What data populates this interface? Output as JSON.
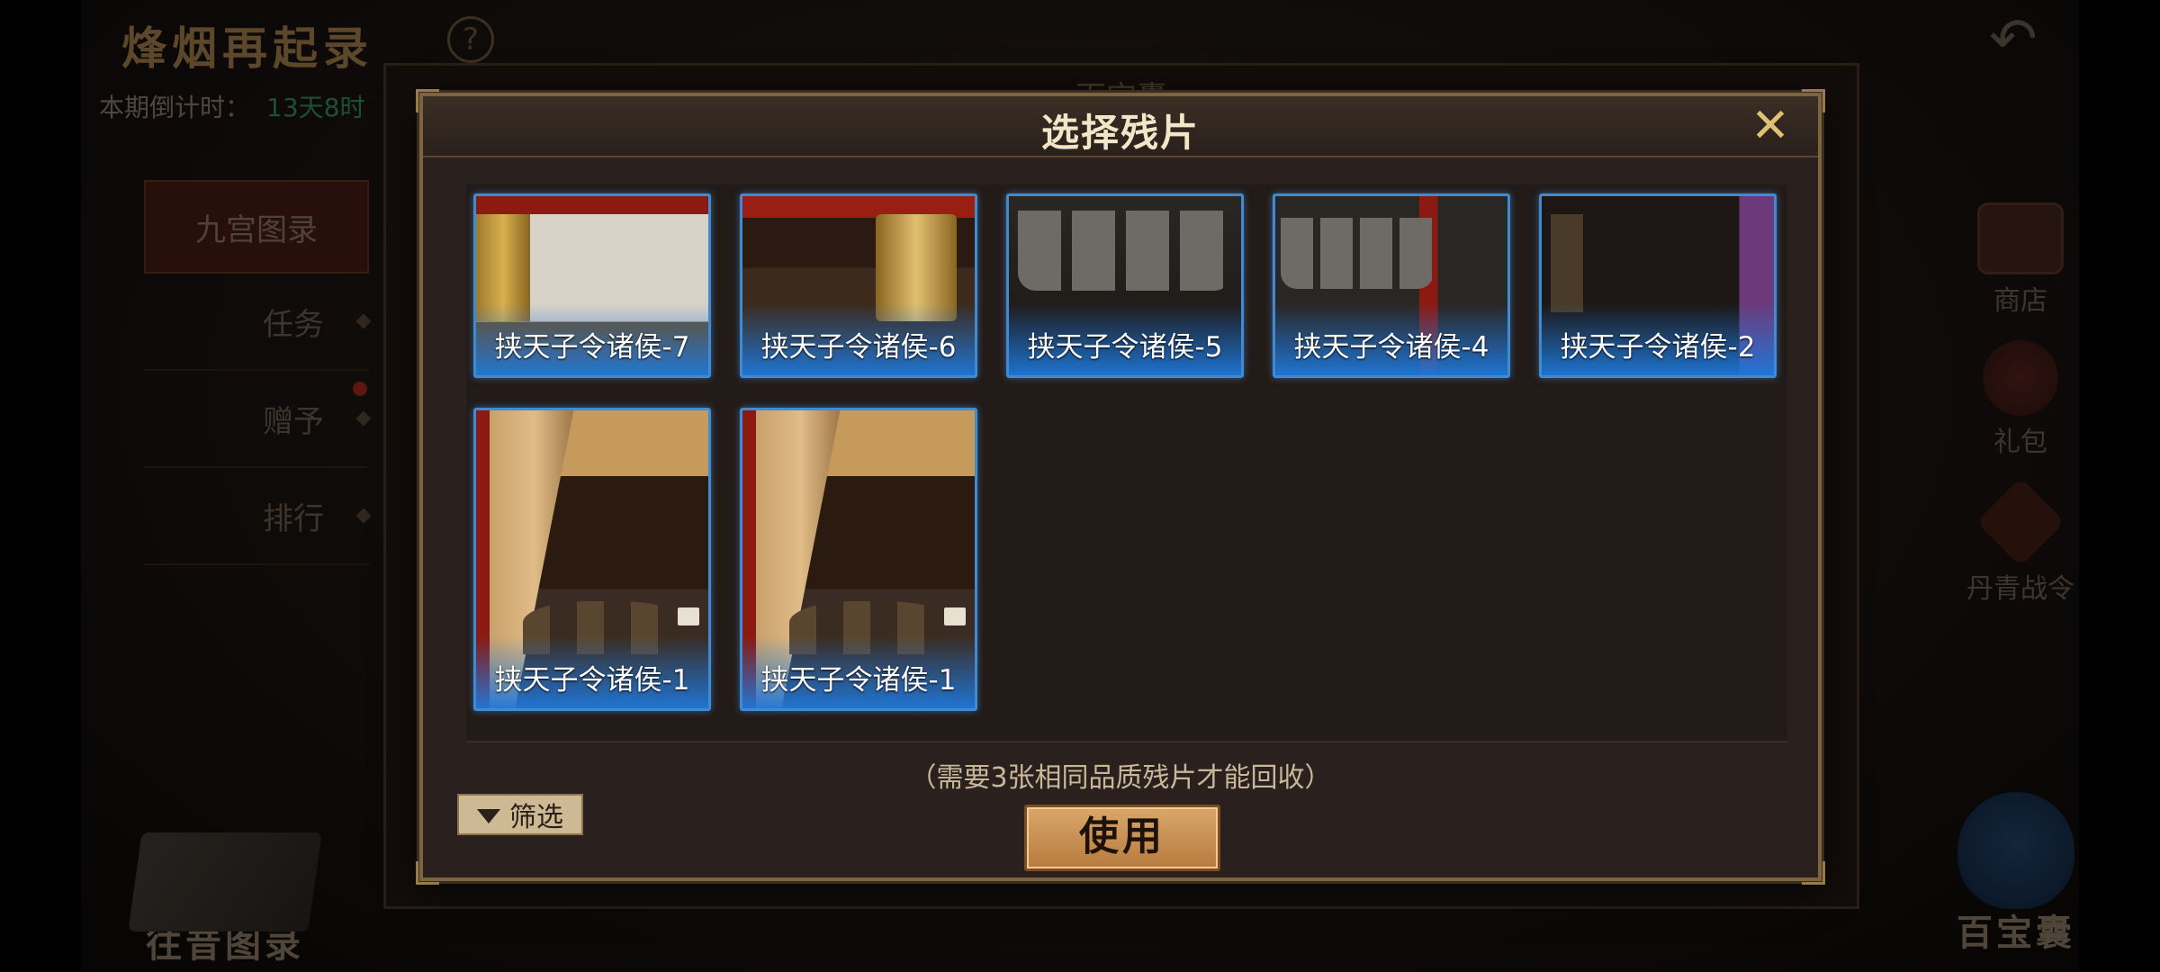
{
  "background": {
    "event_title": "烽烟再起录",
    "help_icon": "?",
    "countdown_label": "本期倒计时：",
    "countdown_value": "13天8时",
    "left_menu": [
      {
        "label": "九宫图录"
      },
      {
        "label": "任务"
      },
      {
        "label": "赠予"
      },
      {
        "label": "排行"
      }
    ],
    "side_buttons": [
      {
        "label": "商店",
        "icon": "chest-icon"
      },
      {
        "label": "礼包",
        "icon": "gift-bag-icon"
      },
      {
        "label": "丹青战令",
        "icon": "battle-pass-icon"
      }
    ],
    "past_catalog_label": "往昔图录",
    "treasure_bag_label": "百宝囊",
    "back_panel_title": "百宝囊"
  },
  "modal": {
    "title": "选择残片",
    "close_icon": "close-icon",
    "fragments": [
      {
        "name": "挟天子令诸侯-7"
      },
      {
        "name": "挟天子令诸侯-6"
      },
      {
        "name": "挟天子令诸侯-5"
      },
      {
        "name": "挟天子令诸侯-4"
      },
      {
        "name": "挟天子令诸侯-2"
      },
      {
        "name": "挟天子令诸侯-1"
      },
      {
        "name": "挟天子令诸侯-1"
      }
    ],
    "hint": "（需要3张相同品质残片才能回收）",
    "filter_label": "筛选",
    "use_label": "使用"
  },
  "colors": {
    "card_border": "#3f8ad0",
    "modal_border": "#7d6440",
    "use_button": "#c98f50",
    "countdown_green": "#2e7a52"
  }
}
